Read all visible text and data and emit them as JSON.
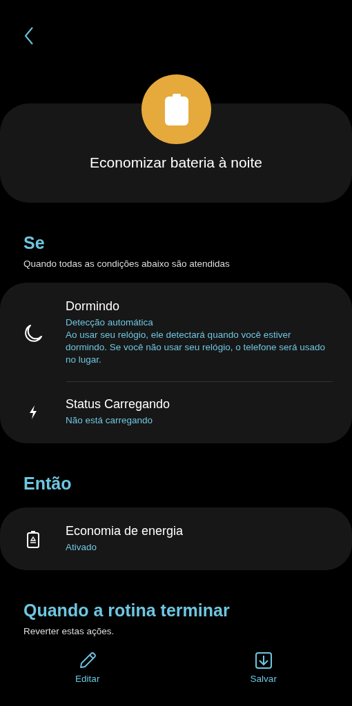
{
  "title": "Economizar bateria à noite",
  "sections": [
    {
      "heading": "Se",
      "subtitle": "Quando todas as condições abaixo são atendidas",
      "items": [
        {
          "kind": "moon",
          "title": "Dormindo",
          "subtitle": "Detecção automática",
          "description": "Ao usar seu relógio, ele detectará quando você estiver dormindo. Se você não usar seu relógio, o telefone será usado no lugar."
        },
        {
          "kind": "bolt",
          "title": "Status Carregando",
          "subtitle": "Não está carregando"
        }
      ]
    },
    {
      "heading": "Então",
      "items": [
        {
          "kind": "battery",
          "title": "Economia de energia",
          "subtitle": "Ativado"
        }
      ]
    },
    {
      "heading": "Quando a rotina terminar",
      "subtitle": "Reverter estas ações."
    }
  ],
  "actions": [
    {
      "kind": "edit",
      "label": "Editar"
    },
    {
      "kind": "save",
      "label": "Salvar"
    }
  ]
}
